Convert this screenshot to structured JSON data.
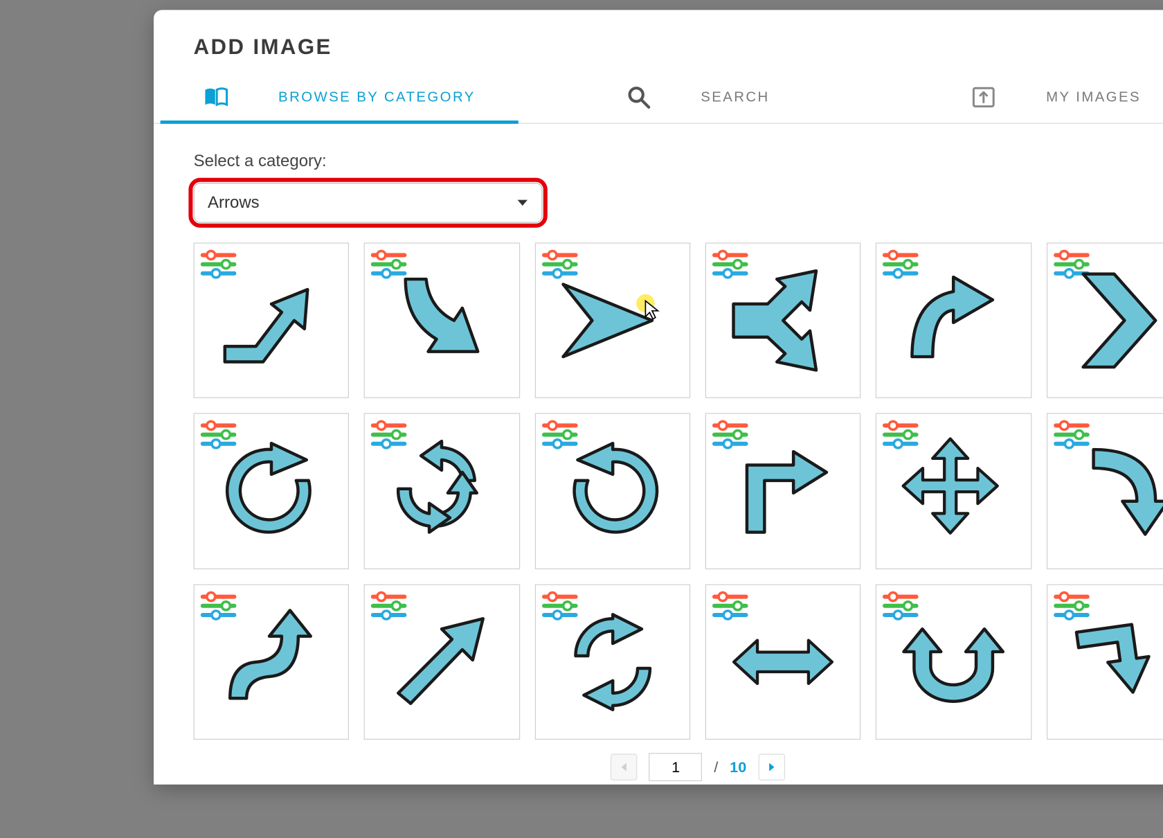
{
  "colors": {
    "accent": "#0aa0d6",
    "highlight_border": "#e3000b",
    "arrow_fill": "#6ec4d7",
    "arrow_stroke": "#1a1a1a",
    "badge_red": "#ff5a3c",
    "badge_green": "#3fbf4a",
    "badge_blue": "#2aa9e0"
  },
  "modal": {
    "title": "ADD IMAGE"
  },
  "tabs": {
    "active_index": 0,
    "items": [
      {
        "id": "browse",
        "label": "BROWSE BY CATEGORY",
        "icon": "book-icon"
      },
      {
        "id": "search",
        "label": "SEARCH",
        "icon": "search-icon"
      },
      {
        "id": "myimages",
        "label": "MY IMAGES",
        "icon": "upload-icon"
      }
    ]
  },
  "category": {
    "label": "Select a category:",
    "selected": "Arrows"
  },
  "grid": {
    "columns": 6,
    "rows_visible": 3,
    "items": [
      {
        "id": "arrow-up-right-bent"
      },
      {
        "id": "arrow-curve-down-right"
      },
      {
        "id": "arrow-pointer-right"
      },
      {
        "id": "arrow-split-fork"
      },
      {
        "id": "arrow-curve-up-right"
      },
      {
        "id": "arrow-chevron-right"
      },
      {
        "id": "arrow-rotate-cw-open"
      },
      {
        "id": "arrow-cycle-three"
      },
      {
        "id": "arrow-rotate-ccw-open"
      },
      {
        "id": "arrow-corner-up-right"
      },
      {
        "id": "arrow-move-four-way"
      },
      {
        "id": "arrow-curve-down"
      },
      {
        "id": "arrow-s-curve"
      },
      {
        "id": "arrow-diagonal-up-right"
      },
      {
        "id": "arrow-refresh-two"
      },
      {
        "id": "arrow-left-right"
      },
      {
        "id": "arrow-u-turn-up"
      },
      {
        "id": "arrow-elbow-right"
      }
    ]
  },
  "pagination": {
    "current": "1",
    "separator": "/",
    "total": "10",
    "prev_enabled": false,
    "next_enabled": true
  },
  "cursor": {
    "on_tile_index": 2
  }
}
